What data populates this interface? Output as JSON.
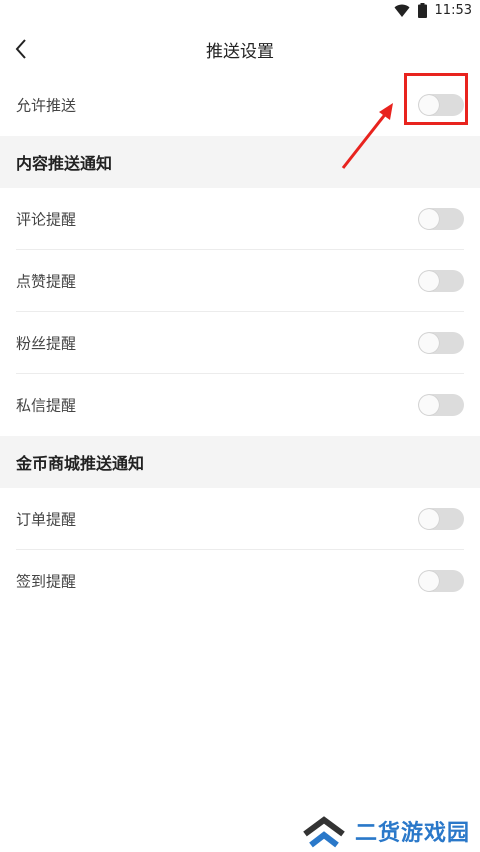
{
  "status_bar": {
    "time": "11:53",
    "icons": [
      "wifi-icon",
      "battery-icon"
    ]
  },
  "header": {
    "title": "推送设置",
    "back_icon": "chevron-left-icon"
  },
  "allow_push": {
    "label": "允许推送",
    "enabled": false
  },
  "sections": [
    {
      "title": "内容推送通知",
      "items": [
        {
          "label": "评论提醒",
          "enabled": false
        },
        {
          "label": "点赞提醒",
          "enabled": false
        },
        {
          "label": "粉丝提醒",
          "enabled": false
        },
        {
          "label": "私信提醒",
          "enabled": false
        }
      ]
    },
    {
      "title": "金币商城推送通知",
      "items": [
        {
          "label": "订单提醒",
          "enabled": false
        },
        {
          "label": "签到提醒",
          "enabled": false
        }
      ]
    }
  ],
  "annotation": {
    "color": "#e8231e"
  },
  "watermark": {
    "text": "二货游戏园",
    "logo_icon": "double-chevron-up-icon",
    "color": "#2a78c9"
  }
}
